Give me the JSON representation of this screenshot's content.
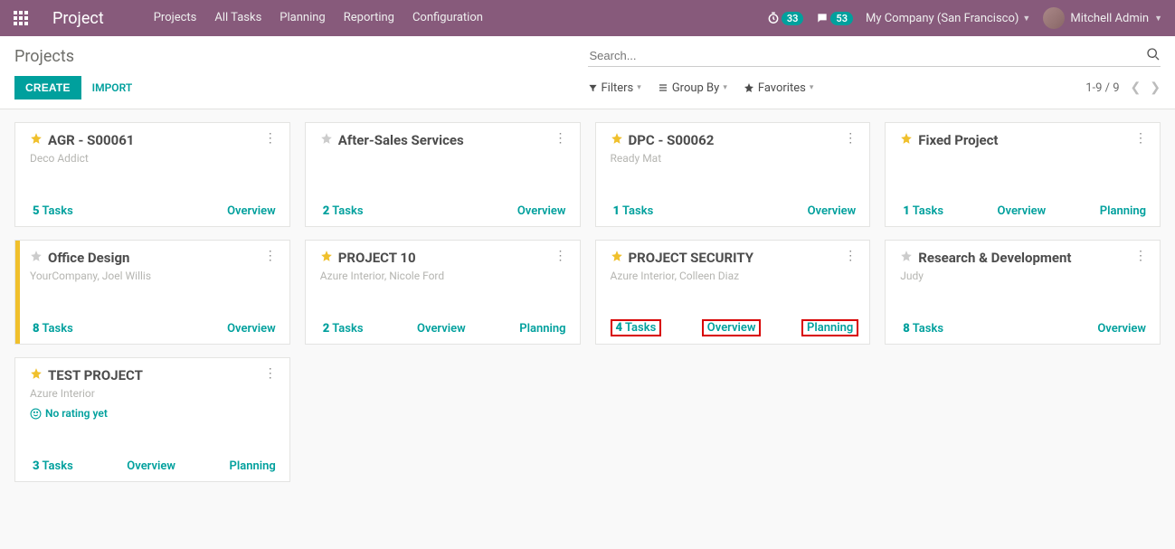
{
  "nav": {
    "brand": "Project",
    "items": [
      "Projects",
      "All Tasks",
      "Planning",
      "Reporting",
      "Configuration"
    ],
    "timer_badge": "33",
    "msg_badge": "53",
    "company": "My Company (San Francisco)",
    "user": "Mitchell Admin"
  },
  "cp": {
    "breadcrumb": "Projects",
    "search_placeholder": "Search...",
    "create": "CREATE",
    "import": "IMPORT",
    "filters_label": "Filters",
    "groupby_label": "Group By",
    "favorites_label": "Favorites",
    "pager": "1-9 / 9"
  },
  "labels": {
    "overview": "Overview",
    "planning": "Planning",
    "tasks_word": "Tasks",
    "no_rating": "No rating yet"
  },
  "cards": [
    {
      "title": "AGR - S00061",
      "subtitle": "Deco Addict",
      "starred": true,
      "tasks": 5,
      "overview": true,
      "planning": false,
      "stripe": false,
      "highlight": false,
      "rating": false
    },
    {
      "title": "After-Sales Services",
      "subtitle": "",
      "starred": false,
      "tasks": 2,
      "overview": true,
      "planning": false,
      "stripe": false,
      "highlight": false,
      "rating": false
    },
    {
      "title": "DPC - S00062",
      "subtitle": "Ready Mat",
      "starred": true,
      "tasks": 1,
      "overview": true,
      "planning": false,
      "stripe": false,
      "highlight": false,
      "rating": false
    },
    {
      "title": "Fixed Project",
      "subtitle": "",
      "starred": true,
      "tasks": 1,
      "overview": true,
      "planning": true,
      "stripe": false,
      "highlight": false,
      "rating": false
    },
    {
      "title": "Office Design",
      "subtitle": "YourCompany, Joel Willis",
      "starred": false,
      "tasks": 8,
      "overview": true,
      "planning": false,
      "stripe": true,
      "highlight": false,
      "rating": false
    },
    {
      "title": "PROJECT 10",
      "subtitle": "Azure Interior, Nicole Ford",
      "starred": true,
      "tasks": 2,
      "overview": true,
      "planning": true,
      "stripe": false,
      "highlight": false,
      "rating": false
    },
    {
      "title": "PROJECT SECURITY",
      "subtitle": "Azure Interior, Colleen Diaz",
      "starred": true,
      "tasks": 4,
      "overview": true,
      "planning": true,
      "stripe": false,
      "highlight": true,
      "rating": false
    },
    {
      "title": "Research & Development",
      "subtitle": "Judy",
      "starred": false,
      "tasks": 8,
      "overview": true,
      "planning": false,
      "stripe": false,
      "highlight": false,
      "rating": false
    },
    {
      "title": "TEST PROJECT",
      "subtitle": "Azure Interior",
      "starred": true,
      "tasks": 3,
      "overview": true,
      "planning": true,
      "stripe": false,
      "highlight": false,
      "rating": true
    }
  ]
}
